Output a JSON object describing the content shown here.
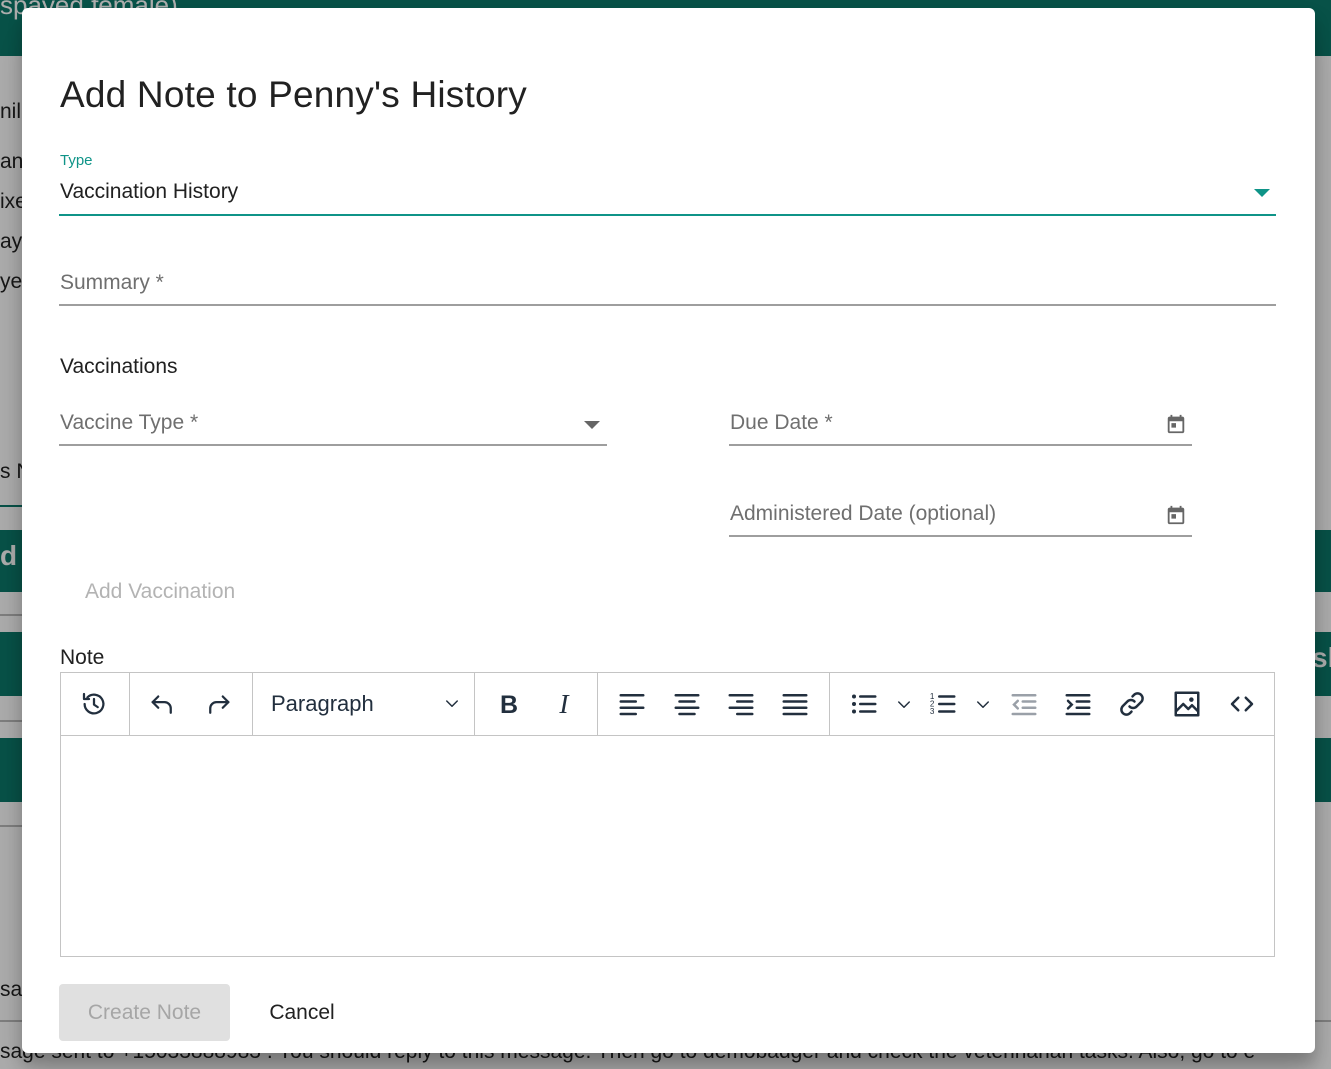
{
  "background": {
    "header_fragment": "spayed female)",
    "side_fragments": [
      "nil",
      "ani",
      "ixe",
      "ay",
      "ye",
      "s N",
      "d",
      "sk",
      "sa"
    ],
    "bottom_fragment": "sage sent to +15033888983 . You should reply to this message. Then go to demobadger and check the veterinarian tasks. Also, go to e"
  },
  "dialog": {
    "title": "Add Note to Penny's History",
    "type_field": {
      "label": "Type",
      "value": "Vaccination History",
      "icon": "dropdown-arrow-icon"
    },
    "summary_field": {
      "placeholder": "Summary *"
    },
    "vaccinations": {
      "heading": "Vaccinations",
      "vaccine_type": {
        "placeholder": "Vaccine Type *",
        "icon": "dropdown-arrow-icon"
      },
      "due_date": {
        "placeholder": "Due Date *",
        "icon": "calendar-icon"
      },
      "administered_date": {
        "placeholder": "Administered Date (optional)",
        "icon": "calendar-icon"
      },
      "add_button": "Add Vaccination"
    },
    "note": {
      "label": "Note",
      "toolbar": {
        "block_format": "Paragraph",
        "buttons": [
          "history-icon",
          "undo-icon",
          "redo-icon",
          "bold-icon",
          "italic-icon",
          "align-left-icon",
          "align-center-icon",
          "align-right-icon",
          "justify-icon",
          "bullet-list-icon",
          "numbered-list-icon",
          "outdent-icon",
          "indent-icon",
          "link-icon",
          "image-icon",
          "source-code-icon"
        ]
      }
    },
    "footer": {
      "create_label": "Create Note",
      "cancel_label": "Cancel"
    }
  },
  "colors": {
    "accent": "#0f9488",
    "brand_teal": "#0d7a6a",
    "disabled_text": "#a6a6a6",
    "disabled_bg": "#e0e0e0"
  }
}
